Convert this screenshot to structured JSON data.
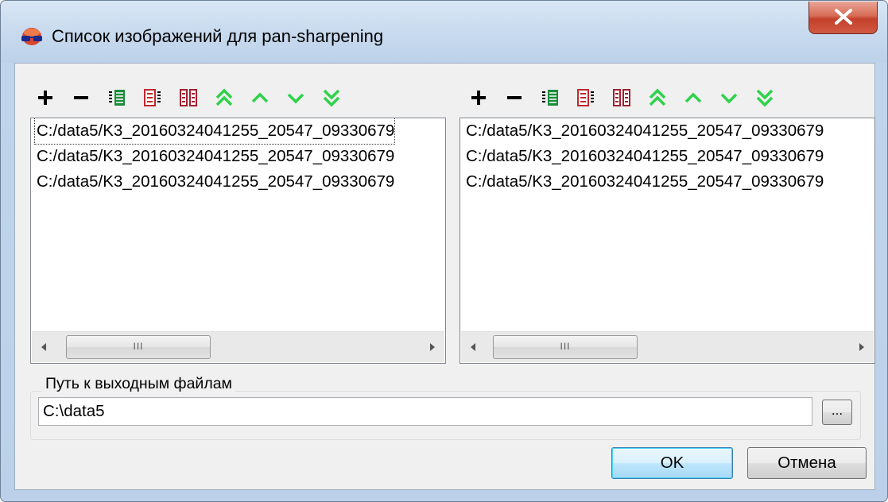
{
  "window": {
    "title": "Список изображений для pan-sharpening"
  },
  "toolbar_icons": [
    "add-icon",
    "remove-icon",
    "insert-list-icon",
    "remove-list-icon",
    "clear-list-icon",
    "move-top-icon",
    "move-up-icon",
    "move-down-icon",
    "move-bottom-icon"
  ],
  "left_list": {
    "items": [
      "C:/data5/K3_20160324041255_20547_09330679",
      "C:/data5/K3_20160324041255_20547_09330679",
      "C:/data5/K3_20160324041255_20547_09330679"
    ]
  },
  "right_list": {
    "items": [
      "C:/data5/K3_20160324041255_20547_09330679",
      "C:/data5/K3_20160324041255_20547_09330679",
      "C:/data5/K3_20160324041255_20547_09330679"
    ]
  },
  "scroll_thumb_grip": "III",
  "output": {
    "label": "Путь к выходным файлам",
    "value": "C:\\data5",
    "browse_label": "..."
  },
  "buttons": {
    "ok": "OK",
    "cancel": "Отмена"
  },
  "colors": {
    "accent_green": "#2fd24a",
    "title_gradient_top": "#d9e7f5",
    "close_red": "#c4402a"
  }
}
